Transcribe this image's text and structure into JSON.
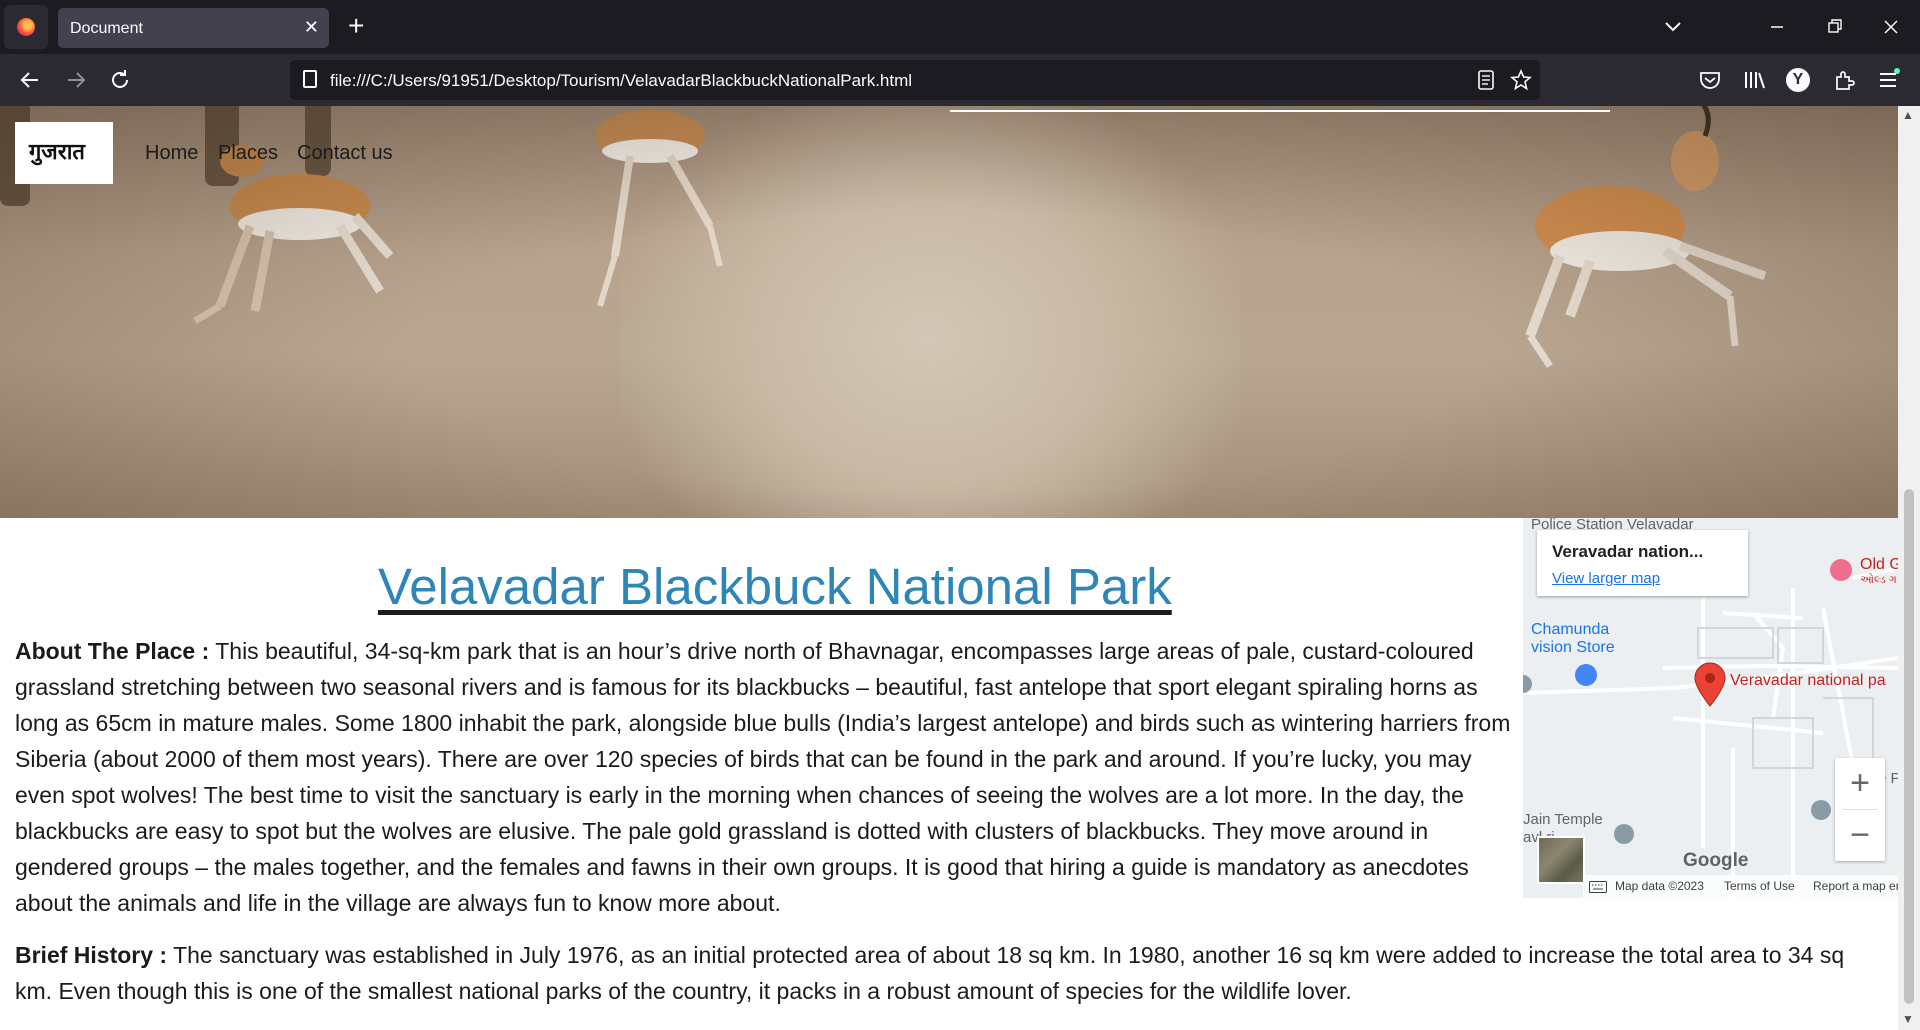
{
  "browser": {
    "tab_title": "Document",
    "tab_close": "✕",
    "new_tab": "+",
    "url": "file:///C:/Users/91951/Desktop/Tourism/VelavadarBlackbuckNationalPark.html",
    "icons": [
      "firefox-logo",
      "back-arrow",
      "forward-arrow",
      "reload",
      "page-info",
      "reader-view",
      "bookmark-star",
      "pocket",
      "library",
      "account",
      "extensions",
      "app-menu",
      "list-all-tabs",
      "minimize",
      "restore",
      "close"
    ],
    "account_initial": "Y"
  },
  "site": {
    "logo_text": "गुजरात",
    "nav": [
      "Home",
      "Places",
      "Contact us"
    ]
  },
  "content": {
    "title": "Velavadar Blackbuck National Park",
    "about_label": "About The Place :",
    "about_text": " This beautiful, 34-sq-km park that is an hour’s drive north of Bhavnagar, encompasses large areas of pale, custard-coloured grassland stretching between two seasonal rivers and is famous for its blackbucks – beautiful, fast antelope that sport elegant spiraling horns as long as 65cm in mature males. Some 1800 inhabit the park, alongside blue bulls (India’s largest antelope) and birds such as wintering harriers from Siberia (about 2000 of them most years). There are over 120 species of birds that can be found in the park and around. If you’re lucky, you may even spot wolves! The best time to visit the sanctuary is early in the morning when chances of seeing the wolves are a lot more. In the day, the blackbucks are easy to spot but the wolves are elusive. The pale gold grassland is dotted with clusters of blackbucks. They move around in gendered groups – the males together, and the females and fawns in their own groups. It is good that hiring a guide is mandatory as anecdotes about the animals and life in the village are always fun to know more about.",
    "history_label": "Brief History :",
    "history_text": " The sanctuary was established in July 1976, as an initial protected area of about 18 sq km. In 1980, another 16 sq km were added to increase the total area to 34 sq km. Even though this is one of the smallest national parks of the country, it packs in a robust amount of species for the wildlife lover."
  },
  "map": {
    "card_title": "Veravadar nation...",
    "card_link": "View larger map",
    "labels": {
      "police": "Police Station Velavadar",
      "chamunda": "Chamunda\nvision Store",
      "pin": "Veravadar national pa",
      "old": "Old G",
      "old_sub": "ઓલ્ડ ગ",
      "jain": "Jain Temple",
      "jain_sub": "avl  ri...",
      "right_p": "e P"
    },
    "zoom_in": "+",
    "zoom_out": "−",
    "google": "Google",
    "footer": [
      "Map data ©2023",
      "Terms of Use",
      "Report a map error"
    ],
    "colors": {
      "pin": "#ea4335",
      "link": "#1a73e8",
      "road": "#ffffff",
      "land": "#eceff1"
    }
  }
}
